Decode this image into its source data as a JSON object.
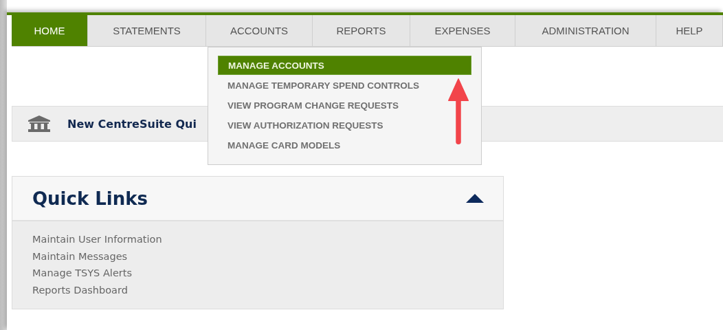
{
  "nav_tabs": [
    {
      "label": "HOME",
      "selected": true
    },
    {
      "label": "STATEMENTS",
      "selected": false
    },
    {
      "label": "ACCOUNTS",
      "selected": false,
      "menu": [
        {
          "label": "MANAGE ACCOUNTS",
          "selected": true
        },
        {
          "label": "MANAGE TEMPORARY SPEND CONTROLS",
          "selected": false
        },
        {
          "label": "VIEW PROGRAM CHANGE REQUESTS",
          "selected": false
        },
        {
          "label": "VIEW AUTHORIZATION REQUESTS",
          "selected": false
        },
        {
          "label": "MANAGE CARD MODELS",
          "selected": false
        }
      ]
    },
    {
      "label": "REPORTS",
      "selected": false
    },
    {
      "label": "EXPENSES",
      "selected": false
    },
    {
      "label": "ADMINISTRATION",
      "selected": false
    },
    {
      "label": "HELP",
      "selected": false
    }
  ],
  "banner": {
    "title": "New CentreSuite Qui"
  },
  "quick_links": {
    "title": "Quick Links",
    "expanded": true,
    "links": [
      "Maintain User Information",
      "Maintain Messages",
      "Manage TSYS Alerts",
      "Reports Dashboard"
    ]
  }
}
